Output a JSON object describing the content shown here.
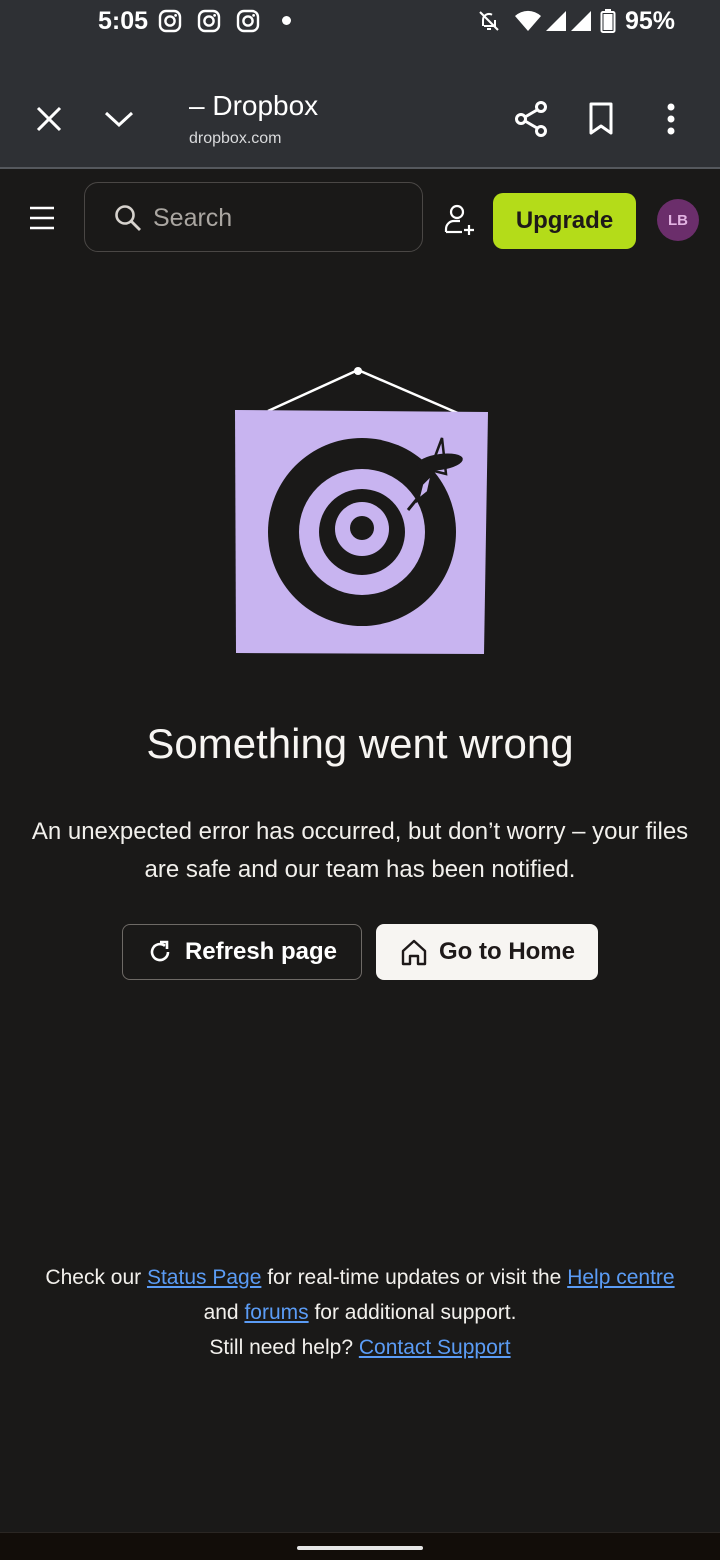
{
  "status_bar": {
    "time": "5:05",
    "battery": "95%",
    "icons": [
      "instagram-icon",
      "instagram-icon",
      "instagram-icon",
      "notification-dot",
      "bell-off-icon",
      "wifi-icon",
      "signal-icon",
      "signal-icon",
      "battery-icon"
    ]
  },
  "browser": {
    "title": "– Dropbox",
    "url": "dropbox.com"
  },
  "header": {
    "search_placeholder": "Search",
    "upgrade_label": "Upgrade",
    "avatar_initials": "LB"
  },
  "error": {
    "title": "Something went wrong",
    "description": "An unexpected error has occurred, but don’t worry – your files are safe and our team has been notified.",
    "refresh_label": "Refresh page",
    "home_label": "Go to Home"
  },
  "help": {
    "part1": "Check our ",
    "status_link": "Status Page",
    "part2": " for real-time updates or visit the ",
    "help_link": "Help centre",
    "part3": " and ",
    "forums_link": "forums",
    "part4": " for additional support.",
    "part5": "Still need help? ",
    "contact_link": "Contact Support"
  },
  "colors": {
    "background": "#1a1918",
    "upgrade": "#b4dc19",
    "avatar": "#6b2e6b",
    "illustration": "#c8b4f0",
    "link": "#5b9cf5"
  }
}
